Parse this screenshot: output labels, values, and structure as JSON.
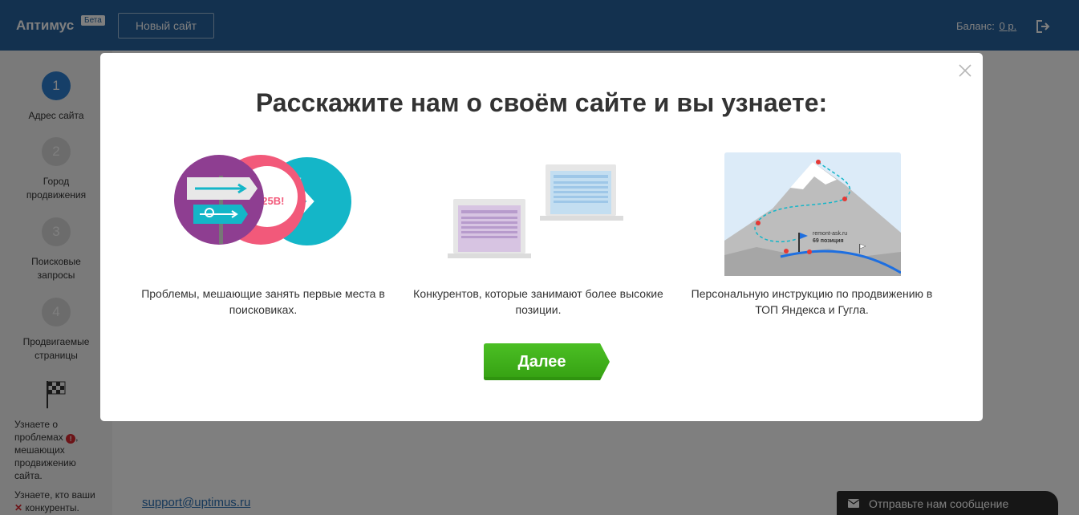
{
  "header": {
    "logo": "Аптимус",
    "beta_badge": "Бета",
    "new_site_button": "Новый сайт",
    "balance_label": "Баланс:",
    "balance_value": "0 р.",
    "logout_icon": "logout-icon"
  },
  "sidebar": {
    "steps": [
      {
        "number": "1",
        "label": "Адрес сайта",
        "active": true
      },
      {
        "number": "2",
        "label": "Город продвижения",
        "active": false
      },
      {
        "number": "3",
        "label": "Поисковые запросы",
        "active": false
      },
      {
        "number": "4",
        "label": "Продвигаемые страницы",
        "active": false
      }
    ],
    "flag_icon": "checkered-flag-icon",
    "learn_problems": "Узнаете о проблемах",
    "learn_problems_tail": "мешающих продвижению сайта.",
    "learn_competitors": "Узнаете, кто ваши",
    "learn_competitors_tail": "конкуренты."
  },
  "footer": {
    "support_email": "support@uptimus.ru",
    "chat_label": "Отправьте нам сообщение"
  },
  "modal": {
    "title": "Расскажите нам о своём сайте и вы узнаете:",
    "features": [
      {
        "text": "Проблемы, мешающие занять первые места в поисковиках."
      },
      {
        "text": "Конкурентов, которые занимают более высокие позиции."
      },
      {
        "text": "Персональную инструкцию по продвижению в ТОП Яндекса и Гугла."
      }
    ],
    "illustration_labels": {
      "error_bubble": "325B!",
      "site_name": "remont-ask.ru",
      "position": "69 позиция"
    },
    "next_button": "Далее"
  },
  "colors": {
    "header_bg": "#26629f",
    "active_step": "#2c7fd1",
    "next_button": "#3fae1a",
    "link": "#2a6fb3"
  }
}
